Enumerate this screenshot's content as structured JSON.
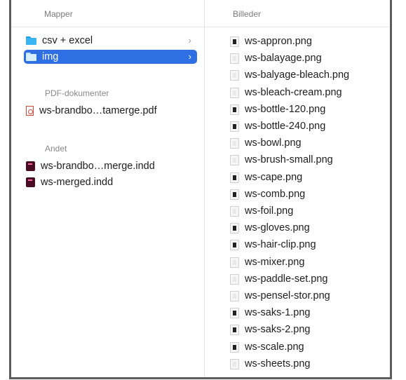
{
  "columns": {
    "left_header": "Mapper",
    "right_header": "Billeder"
  },
  "folders": [
    {
      "label": "csv + excel",
      "chevron": "›",
      "icon": "folder-icon",
      "selected": false
    },
    {
      "label": "img",
      "chevron": "›",
      "icon": "folder-icon",
      "selected": true
    }
  ],
  "sections": {
    "pdf_heading": "PDF-dokumenter",
    "other_heading": "Andet"
  },
  "pdf_files": [
    {
      "label": "ws-brandbo…tamerge.pdf",
      "icon": "pdf-icon"
    }
  ],
  "other_files": [
    {
      "label": "ws-brandbo…merge.indd",
      "icon": "indesign-icon"
    },
    {
      "label": "ws-merged.indd",
      "icon": "indesign-icon"
    }
  ],
  "images": [
    {
      "label": "ws-appron.png",
      "thumb": "dark"
    },
    {
      "label": "ws-balayage.png",
      "thumb": "light"
    },
    {
      "label": "ws-balyage-bleach.png",
      "thumb": "light"
    },
    {
      "label": "ws-bleach-cream.png",
      "thumb": "light"
    },
    {
      "label": "ws-bottle-120.png",
      "thumb": "dark"
    },
    {
      "label": "ws-bottle-240.png",
      "thumb": "dark"
    },
    {
      "label": "ws-bowl.png",
      "thumb": "light"
    },
    {
      "label": "ws-brush-small.png",
      "thumb": "light"
    },
    {
      "label": "ws-cape.png",
      "thumb": "dark"
    },
    {
      "label": "ws-comb.png",
      "thumb": "dark"
    },
    {
      "label": "ws-foil.png",
      "thumb": "light"
    },
    {
      "label": "ws-gloves.png",
      "thumb": "dark"
    },
    {
      "label": "ws-hair-clip.png",
      "thumb": "dark"
    },
    {
      "label": "ws-mixer.png",
      "thumb": "light"
    },
    {
      "label": "ws-paddle-set.png",
      "thumb": "light"
    },
    {
      "label": "ws-pensel-stor.png",
      "thumb": "light"
    },
    {
      "label": "ws-saks-1.png",
      "thumb": "dark"
    },
    {
      "label": "ws-saks-2.png",
      "thumb": "dark"
    },
    {
      "label": "ws-scale.png",
      "thumb": "dark"
    },
    {
      "label": "ws-sheets.png",
      "thumb": "light"
    }
  ],
  "colors": {
    "selection": "#2f6fe4",
    "folder": "#3ab3f3",
    "frame_border": "#5c5c5c"
  }
}
